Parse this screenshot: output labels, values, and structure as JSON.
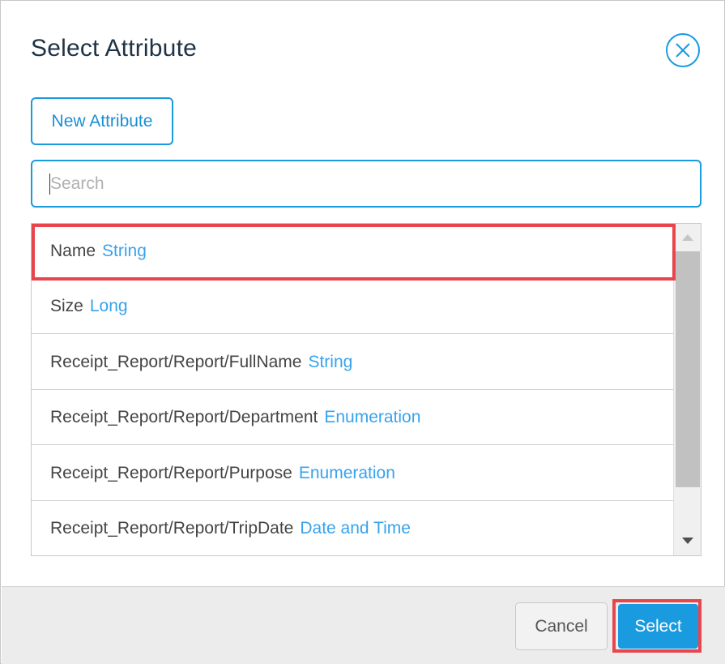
{
  "dialog": {
    "title": "Select Attribute",
    "close_icon": "close-icon"
  },
  "toolbar": {
    "new_attribute_label": "New Attribute"
  },
  "search": {
    "value": "",
    "placeholder": "Search"
  },
  "attributes": [
    {
      "name": "Name",
      "type": "String",
      "highlighted": true
    },
    {
      "name": "Size",
      "type": "Long"
    },
    {
      "name": "Receipt_Report/Report/FullName",
      "type": "String"
    },
    {
      "name": "Receipt_Report/Report/Department",
      "type": "Enumeration"
    },
    {
      "name": "Receipt_Report/Report/Purpose",
      "type": "Enumeration"
    },
    {
      "name": "Receipt_Report/Report/TripDate",
      "type": "Date and Time"
    }
  ],
  "footer": {
    "cancel_label": "Cancel",
    "select_label": "Select"
  },
  "colors": {
    "accent": "#1a9be0",
    "type_text": "#37a3ec",
    "highlight": "#e8454d"
  }
}
